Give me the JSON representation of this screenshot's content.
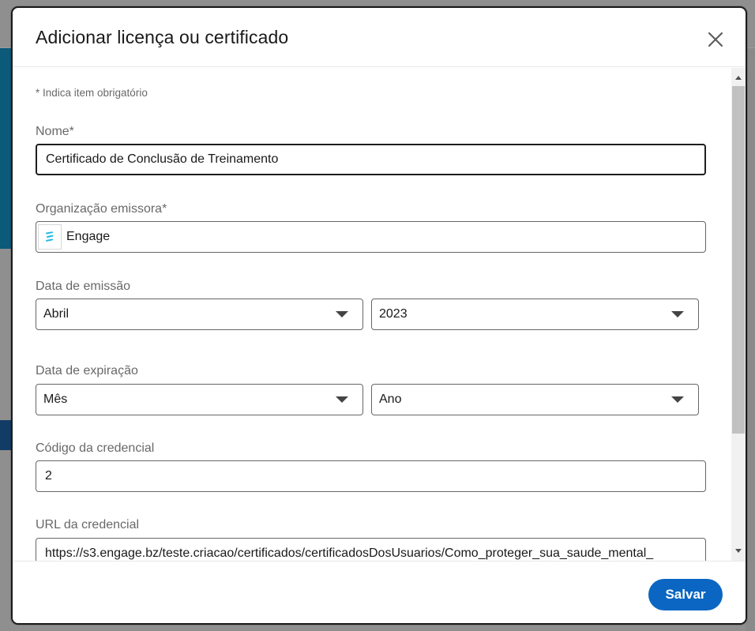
{
  "modal": {
    "title": "Adicionar licença ou certificado",
    "close_icon": "close-icon",
    "required_note": "* Indica item obrigatório"
  },
  "form": {
    "name": {
      "label": "Nome*",
      "value": "Certificado de Conclusão de Treinamento"
    },
    "organization": {
      "label": "Organização emissora*",
      "value": "Engage",
      "logo_icon": "engage-logo-icon",
      "logo_color": "#1fb8e6"
    },
    "issue_date": {
      "label": "Data de emissão",
      "month": "Abril",
      "year": "2023"
    },
    "expiration_date": {
      "label": "Data de expiração",
      "month": "Mês",
      "year": "Ano"
    },
    "credential_id": {
      "label": "Código da credencial",
      "value": "2"
    },
    "credential_url": {
      "label": "URL da credencial",
      "value": "https://s3.engage.bz/teste.criacao/certificados/certificadosDosUsuarios/Como_proteger_sua_saude_mental_"
    }
  },
  "footer": {
    "save_label": "Salvar"
  },
  "colors": {
    "primary": "#0a66c2",
    "overlay": "#8f8f8f"
  }
}
